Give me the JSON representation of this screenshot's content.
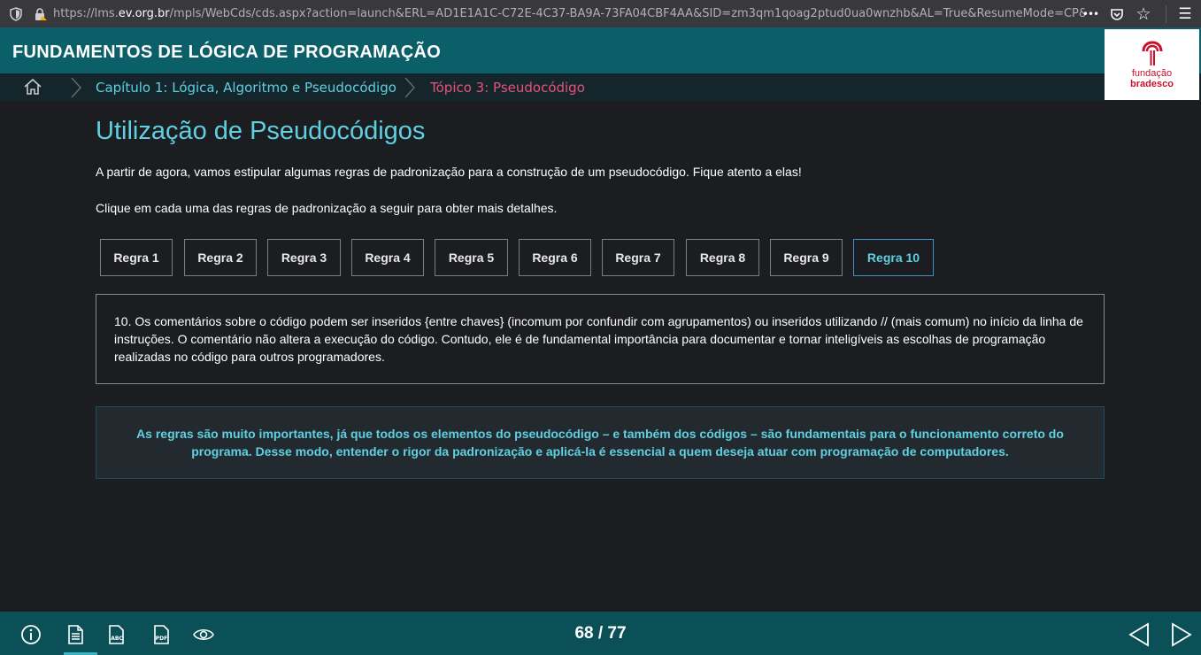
{
  "browser": {
    "url_prefix": "https://lms.",
    "url_domain": "ev.org.br",
    "url_rest": "/mpls/WebCds/cds.aspx?action=launch&ERL=AD1E1A1C-C72E-4C37-BA9A-73FA04CBF4AA&SID=zm3qm1qoag2ptud0ua0wnzhb&AL=True&ResumeMode=CP&DCM=",
    "icons": [
      "shield-icon",
      "lock-icon",
      "more-icon",
      "pocket-icon",
      "bookmark-star-icon",
      "menu-icon"
    ],
    "more_glyph": "•••",
    "menu_glyph": "☰",
    "star_glyph": "☆"
  },
  "header": {
    "course_title": "FUNDAMENTOS DE LÓGICA DE PROGRAMAÇÃO",
    "logo": {
      "line1": "fundação",
      "line2": "bradesco"
    },
    "color": "#0b5f68"
  },
  "breadcrumb": {
    "chapter": "Capítulo 1: Lógica, Algoritmo e Pseudocódigo",
    "topic": "Tópico 3: Pseudocódigo",
    "chapter_color": "#5fd0e0",
    "topic_color": "#e8527a"
  },
  "main": {
    "title": "Utilização de Pseudocódigos",
    "intro": "A partir de agora, vamos estipular algumas regras de padronização para a construção de um pseudocódigo. Fique atento a elas!",
    "instruction": "Clique em cada uma das regras de padronização a seguir para obter mais detalhes.",
    "rules": [
      "Regra 1",
      "Regra 2",
      "Regra 3",
      "Regra 4",
      "Regra 5",
      "Regra 6",
      "Regra 7",
      "Regra 8",
      "Regra 9",
      "Regra 10"
    ],
    "active_rule_index": 9,
    "rule_detail": "10. Os comentários sobre o código podem ser inseridos {entre chaves} (incomum por confundir com agrupamentos) ou inseridos utilizando // (mais comum) no início da linha de instruções. O comentário não altera a execução do código. Contudo, ele é de fundamental importância para documentar e tornar inteligíveis as escolhas de programação realizadas no código para outros programadores.",
    "note": "As regras são muito importantes, já que todos os elementos do pseudocódigo – e também dos códigos – são fundamentais para o funcionamento correto do programa. Desse modo, entender o rigor da padronização e aplicá-la é essencial a quem deseja atuar com programação de computadores."
  },
  "footer": {
    "icons": [
      "info-icon",
      "document-icon",
      "glossary-abc-icon",
      "pdf-icon",
      "eye-icon"
    ],
    "pdf_label": "PDF",
    "abc_label": "ABC",
    "pager": "68 / 77",
    "nav": [
      "previous-icon",
      "next-icon"
    ]
  }
}
